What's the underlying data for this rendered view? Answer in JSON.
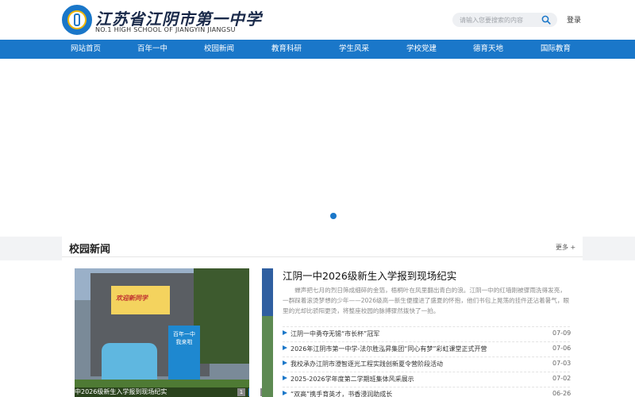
{
  "header": {
    "logo_title": "江苏省江阴市第一中学",
    "logo_subtitle": "NO.1 HIGH SCHOOL OF JIANGYIN JIANGSU",
    "search_placeholder": "请输入您要搜索的内容",
    "login_label": "登录"
  },
  "nav": {
    "items": [
      "网站首页",
      "百年一中",
      "校园新闻",
      "教育科研",
      "学生风采",
      "学校党建",
      "德育天地",
      "国际教育"
    ]
  },
  "news_section": {
    "title": "校园新闻",
    "more_label": "更多 +",
    "photo": {
      "screen_text": "欢迎新同学",
      "sign_text": "百年一中 我来啦",
      "caption": "中2026级新生入学报到现场纪实",
      "pages": [
        "1",
        "2",
        "3"
      ],
      "active_page": 2
    },
    "feature": {
      "title": "江阴一中2026级新生入学报到现场纪实",
      "summary": "蝉声把七月的烈日筛成细碎的金箔，梧桐叶在风里翻出青白的浪。江阴一中的红墙刚被骤雨洗得发亮，一群踩着滚烫梦想的少年——2026级高一新生便撞进了盛夏的怀抱，他们书包上晃荡的挂件还沾着暑气，眼里的光却比骄阳更烫，将整座校园的脉搏骤然拨快了一拍。"
    },
    "list": [
      {
        "title": "江阴一中勇夺无锡“市长杯”冠军",
        "date": "07-09"
      },
      {
        "title": "2026年江阴市第一中学-法尔胜泓昇集团“同心有梦”彩虹课堂正式开营",
        "date": "07-06"
      },
      {
        "title": "我校承办江阴市澄智逐光工程实践创新夏令营阶段活动",
        "date": "07-03"
      },
      {
        "title": "2025-2026学年度第二学期班集体风采展示",
        "date": "07-02"
      },
      {
        "title": "“双高”携手育英才，书香浸润助成长",
        "date": "06-26"
      }
    ]
  }
}
